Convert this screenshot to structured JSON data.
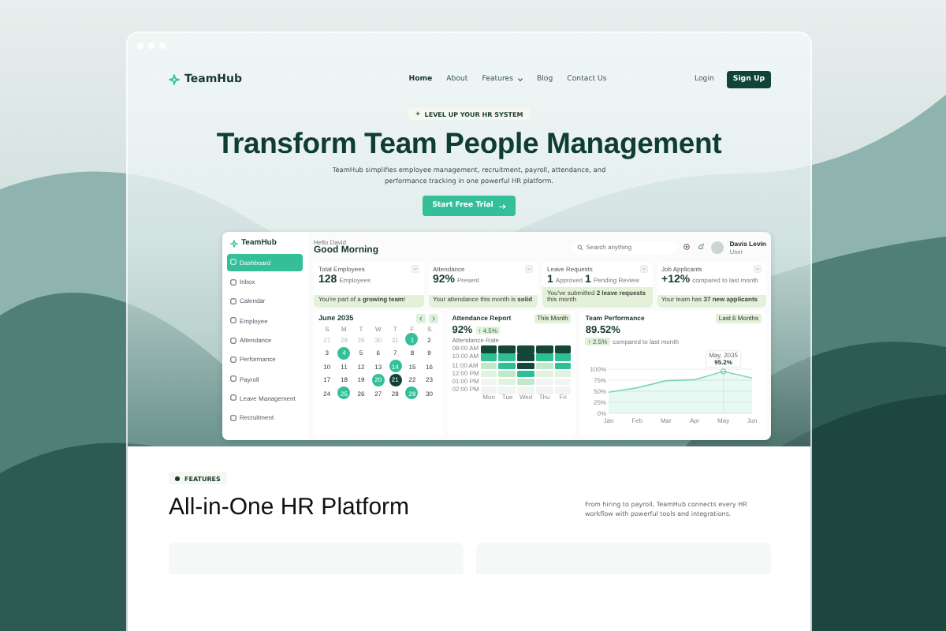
{
  "nav": {
    "logo": "TeamHub",
    "links": [
      {
        "label": "Home",
        "selected": true,
        "dropdown": false
      },
      {
        "label": "About",
        "selected": false,
        "dropdown": false
      },
      {
        "label": "Features",
        "selected": false,
        "dropdown": true
      },
      {
        "label": "Blog",
        "selected": false,
        "dropdown": false
      },
      {
        "label": "Contact Us",
        "selected": false,
        "dropdown": false
      }
    ],
    "login": "Login",
    "signup": "Sign Up"
  },
  "hero": {
    "badge": "LEVEL UP YOUR HR SYSTEM",
    "title": "Transform Team People Management",
    "subtitle": "TeamHub simplifies employee management, recruitment, payroll, attendance, and performance tracking in one powerful HR platform.",
    "cta": "Start Free Trial"
  },
  "dashboard": {
    "logo": "TeamHub",
    "sidebar": [
      {
        "label": "Dashboard",
        "selected": true
      },
      {
        "label": "Inbox",
        "selected": false
      },
      {
        "label": "Calendar",
        "selected": false
      },
      {
        "label": "Employee",
        "selected": false
      },
      {
        "label": "Attendance",
        "selected": false
      },
      {
        "label": "Performance",
        "selected": false
      },
      {
        "label": "Payroll",
        "selected": false
      },
      {
        "label": "Leave Management",
        "selected": false
      },
      {
        "label": "Recruitment",
        "selected": false
      }
    ],
    "greeting": "Hello David",
    "heading": "Good Morning",
    "search": {
      "placeholder": "Search anything"
    },
    "user": {
      "name": "Davis Levin",
      "role": "User"
    },
    "stats": [
      {
        "title": "Total Employees",
        "figures": [
          {
            "value": "128",
            "caption": "Employees"
          }
        ],
        "note": "You're part of a **growing team**!"
      },
      {
        "title": "Attendance",
        "figures": [
          {
            "value": "92%",
            "caption": "Present"
          }
        ],
        "note": "Your attendance this month is **solid**"
      },
      {
        "title": "Leave Requests",
        "figures": [
          {
            "value": "1",
            "caption": "Approved"
          },
          {
            "value": "1",
            "caption": "Pending Review"
          }
        ],
        "note": "You've submitted **2 leave requests** this month"
      },
      {
        "title": "Job Applicants",
        "figures": [
          {
            "value": "+12%",
            "caption": "compared to last month"
          }
        ],
        "note": "Your team has **37 new applicants**"
      }
    ],
    "calendar": {
      "month": "June 2035",
      "weekdays": [
        "S",
        "M",
        "T",
        "W",
        "T",
        "F",
        "S"
      ],
      "weeks": [
        [
          {
            "day": "27",
            "muted": true,
            "event": false,
            "today": false
          },
          {
            "day": "28",
            "muted": true,
            "event": false,
            "today": false
          },
          {
            "day": "29",
            "muted": true,
            "event": false,
            "today": false
          },
          {
            "day": "30",
            "muted": true,
            "event": false,
            "today": false
          },
          {
            "day": "31",
            "muted": true,
            "event": false,
            "today": false
          },
          {
            "day": "1",
            "muted": false,
            "event": true,
            "today": false
          },
          {
            "day": "2",
            "muted": false,
            "event": false,
            "today": false
          }
        ],
        [
          {
            "day": "3",
            "muted": false,
            "event": false,
            "today": false
          },
          {
            "day": "4",
            "muted": false,
            "event": true,
            "today": false
          },
          {
            "day": "5",
            "muted": false,
            "event": false,
            "today": false
          },
          {
            "day": "6",
            "muted": false,
            "event": false,
            "today": false
          },
          {
            "day": "7",
            "muted": false,
            "event": false,
            "today": false
          },
          {
            "day": "8",
            "muted": false,
            "event": false,
            "today": false
          },
          {
            "day": "9",
            "muted": false,
            "event": false,
            "today": false
          }
        ],
        [
          {
            "day": "10",
            "muted": false,
            "event": false,
            "today": false
          },
          {
            "day": "11",
            "muted": false,
            "event": false,
            "today": false
          },
          {
            "day": "12",
            "muted": false,
            "event": false,
            "today": false
          },
          {
            "day": "13",
            "muted": false,
            "event": false,
            "today": false
          },
          {
            "day": "14",
            "muted": false,
            "event": true,
            "today": false
          },
          {
            "day": "15",
            "muted": false,
            "event": false,
            "today": false
          },
          {
            "day": "16",
            "muted": false,
            "event": false,
            "today": false
          }
        ],
        [
          {
            "day": "17",
            "muted": false,
            "event": false,
            "today": false
          },
          {
            "day": "18",
            "muted": false,
            "event": false,
            "today": false
          },
          {
            "day": "19",
            "muted": false,
            "event": false,
            "today": false
          },
          {
            "day": "20",
            "muted": false,
            "event": true,
            "today": false
          },
          {
            "day": "21",
            "muted": false,
            "event": false,
            "today": true
          },
          {
            "day": "22",
            "muted": false,
            "event": false,
            "today": false
          },
          {
            "day": "23",
            "muted": false,
            "event": false,
            "today": false
          }
        ],
        [
          {
            "day": "24",
            "muted": false,
            "event": false,
            "today": false
          },
          {
            "day": "25",
            "muted": false,
            "event": true,
            "today": false
          },
          {
            "day": "26",
            "muted": false,
            "event": false,
            "today": false
          },
          {
            "day": "27",
            "muted": false,
            "event": false,
            "today": false
          },
          {
            "day": "28",
            "muted": false,
            "event": false,
            "today": false
          },
          {
            "day": "29",
            "muted": false,
            "event": true,
            "today": false
          },
          {
            "day": "30",
            "muted": false,
            "event": false,
            "today": false
          }
        ]
      ]
    },
    "attendance": {
      "title": "Attendance Report",
      "filter": "This Month",
      "value": "92%",
      "change": "↑ 4.5%",
      "caption": "Attendance Rate",
      "days": [
        "Mon",
        "Tue",
        "Wed",
        "Thu",
        "Fri"
      ],
      "rows": [
        {
          "time": "09:00 AM",
          "cells": [
            {
              "color": "#14463a"
            },
            {
              "color": "#14463a"
            },
            {
              "color": "#14463a"
            },
            {
              "color": "#14463a"
            },
            {
              "color": "#14463a"
            }
          ]
        },
        {
          "time": "10:00 AM",
          "cells": [
            {
              "color": "#2fbf93"
            },
            {
              "color": "#2fbf93"
            },
            {
              "color": "#14463a"
            },
            {
              "color": "#2fbf93"
            },
            {
              "color": "#2fbf93"
            }
          ]
        },
        {
          "time": "11:00 AM",
          "cells": [
            {
              "color": "#bfe9c9"
            },
            {
              "color": "#2fbf93"
            },
            {
              "color": "#14463a"
            },
            {
              "color": "#bfe9c9"
            },
            {
              "color": "#2fbf93"
            }
          ]
        },
        {
          "time": "12:00 PM",
          "cells": [
            {
              "color": "#e1f3e0"
            },
            {
              "color": "#bfe9c9"
            },
            {
              "color": "#2fbf93"
            },
            {
              "color": "#e1f3e0"
            },
            {
              "color": "#e1f3e0"
            }
          ]
        },
        {
          "time": "01:00 PM",
          "cells": [
            {
              "color": "#f1f4f2"
            },
            {
              "color": "#e1f3e0"
            },
            {
              "color": "#bfe9c9"
            },
            {
              "color": "#f1f4f2"
            },
            {
              "color": "#f1f4f2"
            }
          ]
        },
        {
          "time": "02:00 PM",
          "cells": [
            {
              "color": "#f1f4f2"
            },
            {
              "color": "#f1f4f2"
            },
            {
              "color": "#f1f4f2"
            },
            {
              "color": "#f1f4f2"
            },
            {
              "color": "#f1f4f2"
            }
          ]
        }
      ]
    },
    "performance": {
      "title": "Team Performance",
      "filter": "Last 6 Months",
      "value": "89.52%",
      "change": "↑ 2.5%",
      "caption": "compared to last month",
      "chart_data": {
        "type": "area",
        "grid": true,
        "x": [
          "Jan",
          "Feb",
          "Mar",
          "Apr",
          "May",
          "Jun"
        ],
        "series": [
          {
            "color": "#7fd6b8",
            "values": [
              48,
              58,
              74,
              76,
              95,
              80
            ]
          }
        ],
        "ylim": [
          0,
          100
        ],
        "yticks": [
          {
            "value": 0,
            "label": "0%"
          },
          {
            "value": 25,
            "label": "25%"
          },
          {
            "value": 50,
            "label": "50%"
          },
          {
            "value": 75,
            "label": "75%"
          },
          {
            "value": 100,
            "label": "100%"
          }
        ],
        "annotations": [
          {
            "x": "May",
            "y": 95,
            "text": "95.2%"
          }
        ]
      },
      "tooltip_date": "May, 2035"
    }
  },
  "features": {
    "badge": "FEATURES",
    "title": "All-in-One HR Platform",
    "description": "From hiring to payroll, TeamHub connects every HR workflow with powerful tools and integrations."
  }
}
